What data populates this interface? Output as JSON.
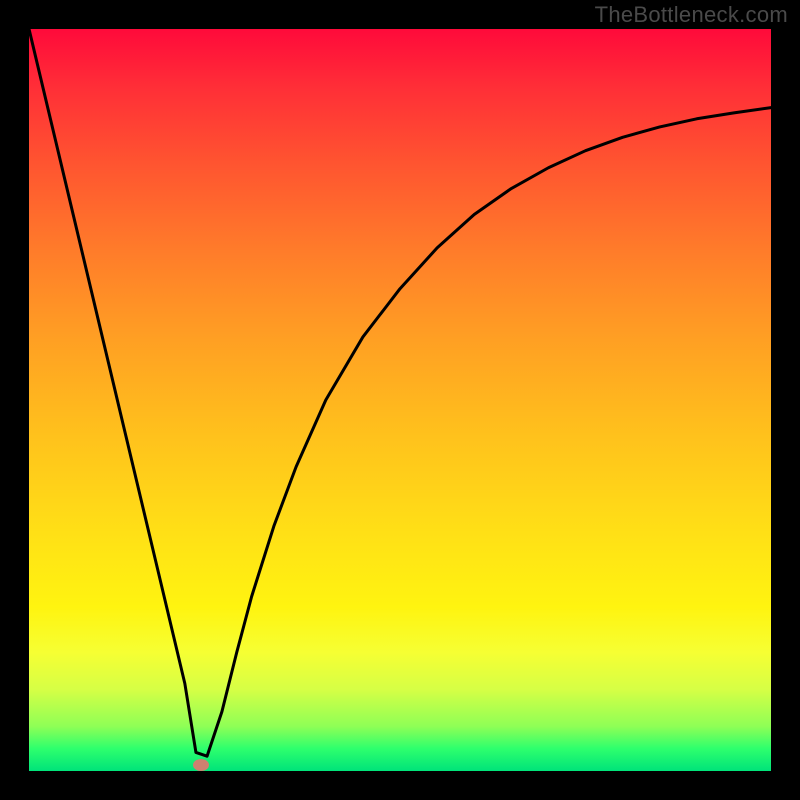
{
  "watermark": "TheBottleneck.com",
  "chart_data": {
    "type": "line",
    "title": "",
    "xlabel": "",
    "ylabel": "",
    "xlim": [
      0,
      100
    ],
    "ylim": [
      0,
      100
    ],
    "series": [
      {
        "name": "curve",
        "x": [
          0,
          3,
          6,
          9,
          12,
          15,
          18,
          21,
          22.5,
          24,
          26,
          28,
          30,
          33,
          36,
          40,
          45,
          50,
          55,
          60,
          65,
          70,
          75,
          80,
          85,
          90,
          95,
          100
        ],
        "y": [
          100,
          87.4,
          74.8,
          62.2,
          49.6,
          37.0,
          24.4,
          11.8,
          2.5,
          2.0,
          8.0,
          16.0,
          23.5,
          33.0,
          41.0,
          50.0,
          58.5,
          65.0,
          70.5,
          75.0,
          78.5,
          81.3,
          83.6,
          85.4,
          86.8,
          87.9,
          88.7,
          89.4
        ]
      }
    ],
    "marker": {
      "x": 23.2,
      "y": 0.8,
      "color": "#cd8170"
    },
    "background_gradient": {
      "type": "vertical",
      "stops": [
        {
          "pos": 0,
          "color": "#ff0a3a"
        },
        {
          "pos": 50,
          "color": "#ffb020"
        },
        {
          "pos": 80,
          "color": "#fff410"
        },
        {
          "pos": 100,
          "color": "#00e37a"
        }
      ]
    },
    "frame_color": "#000000"
  }
}
